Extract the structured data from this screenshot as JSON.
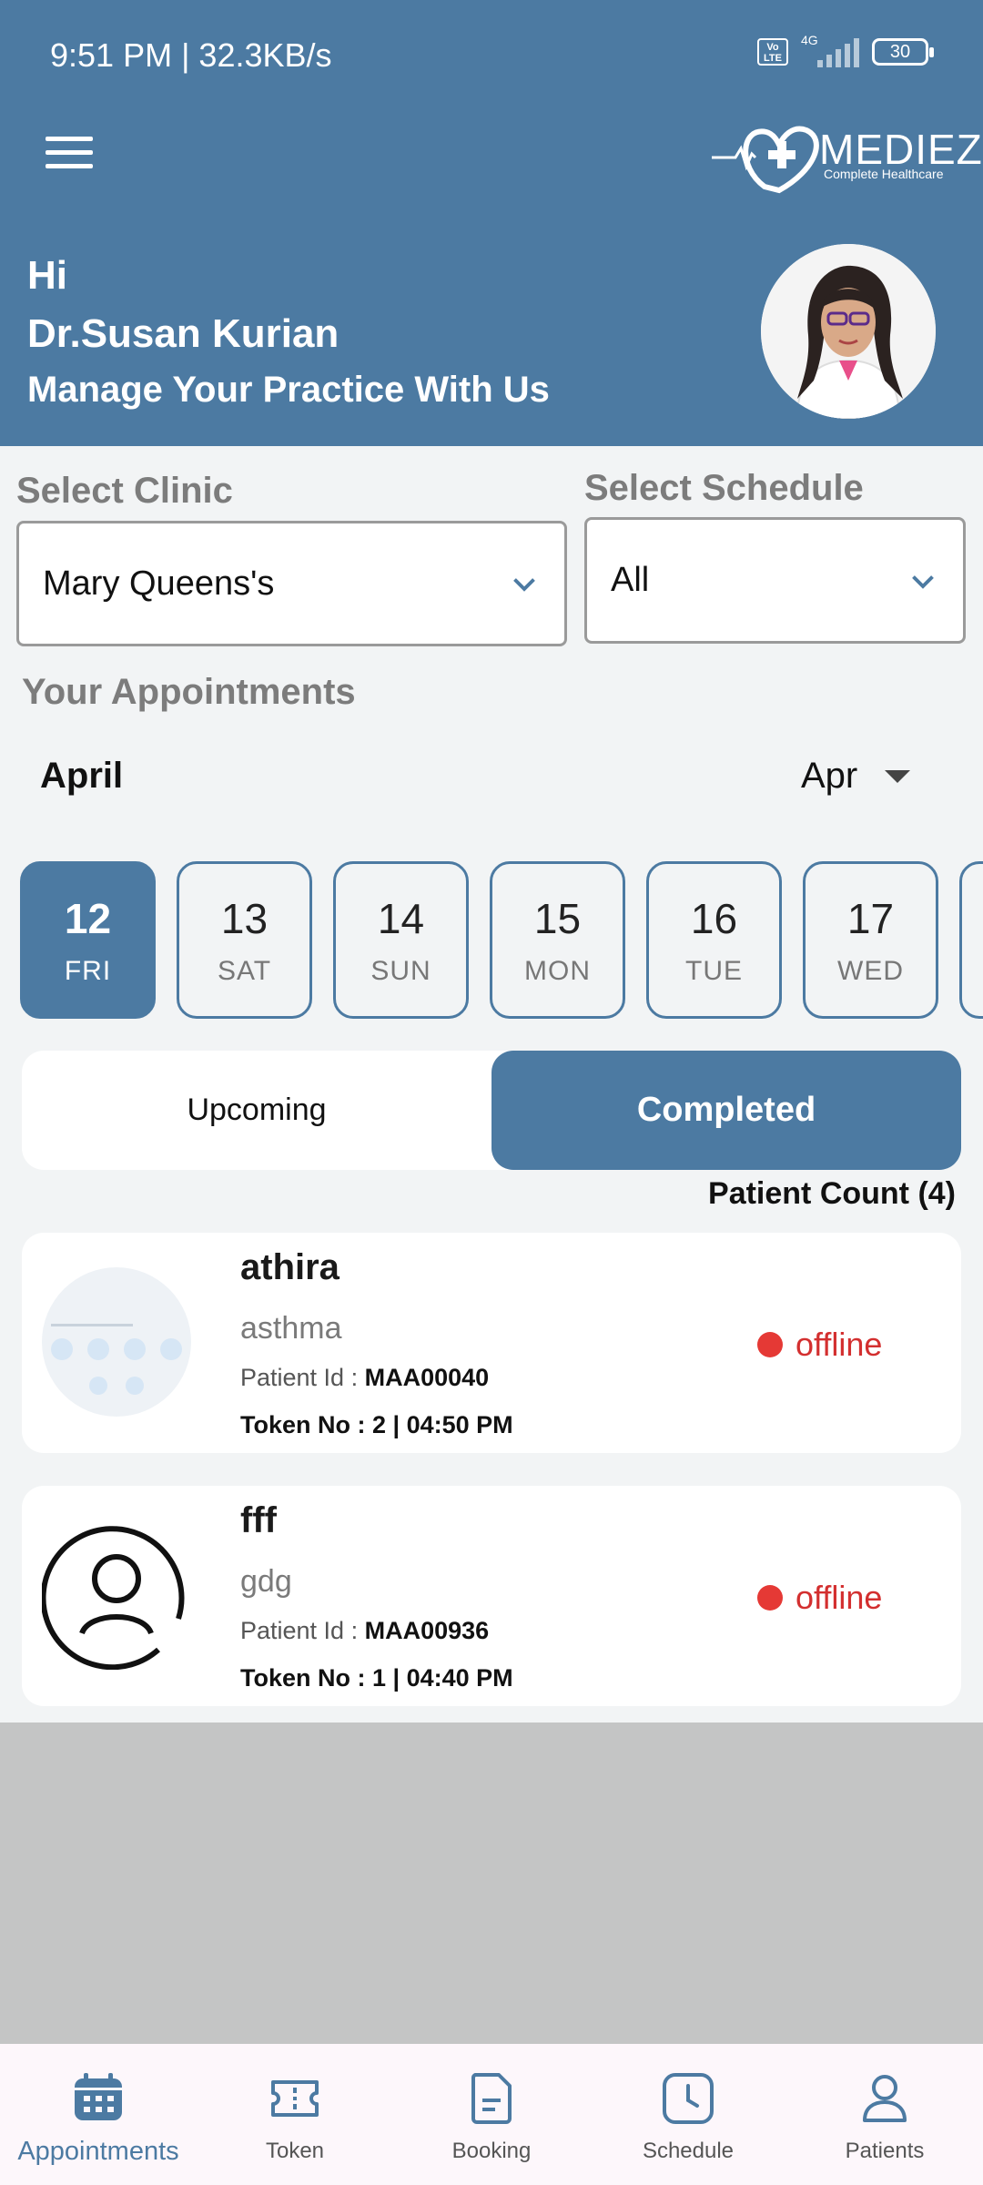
{
  "status_bar": {
    "time": "9:51 PM | 32.3KB/s",
    "network": "4G",
    "volte": "Vo LTE",
    "battery": "30"
  },
  "header": {
    "logo_text": "MEDIEZY",
    "logo_sub": "Complete Healthcare",
    "greeting": "Hi",
    "doctor_name": "Dr.Susan Kurian",
    "tagline": "Manage Your Practice With Us"
  },
  "filters": {
    "clinic_label": "Select Clinic",
    "clinic_value": "Mary Queens's",
    "schedule_label": "Select Schedule",
    "schedule_value": "All"
  },
  "appointments": {
    "title": "Your Appointments",
    "month_label": "April",
    "month_select": "Apr",
    "dates": [
      {
        "num": "12",
        "day": "FRI",
        "active": true
      },
      {
        "num": "13",
        "day": "SAT"
      },
      {
        "num": "14",
        "day": "SUN"
      },
      {
        "num": "15",
        "day": "MON"
      },
      {
        "num": "16",
        "day": "TUE"
      },
      {
        "num": "17",
        "day": "WED"
      },
      {
        "num": "",
        "day": ""
      }
    ],
    "tabs": {
      "upcoming": "Upcoming",
      "completed": "Completed",
      "active": "completed"
    },
    "patient_count": "Patient Count (4)",
    "patients": [
      {
        "name": "athira",
        "condition": "asthma",
        "id_label": "Patient Id : ",
        "id": "MAA00040",
        "token": "Token No : 2 | 04:50 PM",
        "status": "offline",
        "status_color": "#e53935"
      },
      {
        "name": "fff",
        "condition": "gdg",
        "id_label": "Patient Id : ",
        "id": "MAA00936",
        "token": "Token No : 1 | 04:40 PM",
        "status": "offline",
        "status_color": "#e53935"
      }
    ]
  },
  "nav": {
    "items": [
      {
        "label": "Appointments",
        "icon": "calendar-icon",
        "active": true
      },
      {
        "label": "Token",
        "icon": "ticket-icon"
      },
      {
        "label": "Booking",
        "icon": "document-icon"
      },
      {
        "label": "Schedule",
        "icon": "clock-icon"
      },
      {
        "label": "Patients",
        "icon": "person-icon"
      }
    ]
  },
  "colors": {
    "primary": "#4c7aa2",
    "offline": "#e53935",
    "background": "#f2f4f5"
  }
}
